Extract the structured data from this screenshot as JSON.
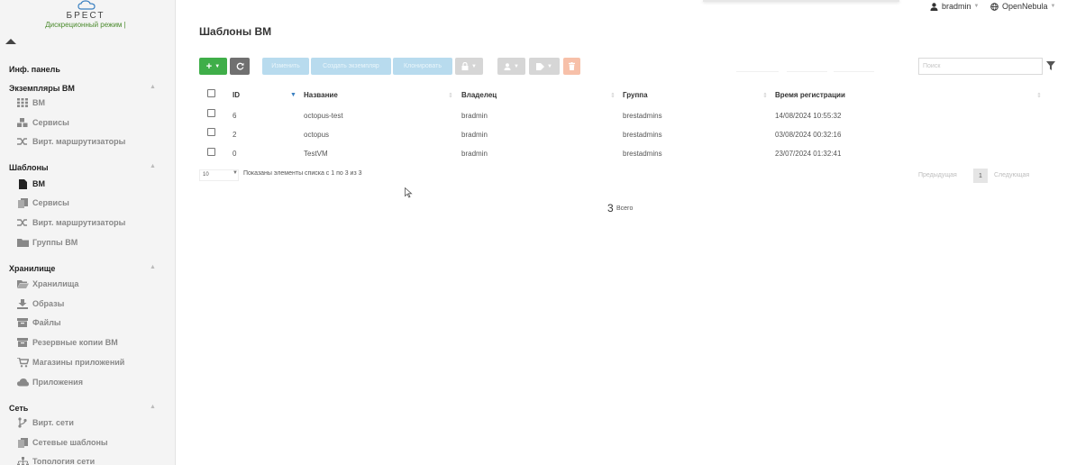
{
  "brand": {
    "name": "БРЕСТ",
    "mode": "Дискреционный режим",
    "mode_suffix": "|"
  },
  "header": {
    "page_title": "Шаблоны ВМ",
    "user": "bradmin",
    "cloud": "OpenNebula"
  },
  "sidebar": {
    "dashboard": "Инф. панель",
    "sections": [
      {
        "title": "Экземпляры ВМ",
        "items": [
          {
            "label": "ВМ",
            "icon": "grid-icon"
          },
          {
            "label": "Сервисы",
            "icon": "cubes-icon"
          },
          {
            "label": "Вирт. маршрутизаторы",
            "icon": "random-icon"
          }
        ]
      },
      {
        "title": "Шаблоны",
        "items": [
          {
            "label": "ВМ",
            "icon": "file-icon",
            "active": true
          },
          {
            "label": "Сервисы",
            "icon": "copy-icon"
          },
          {
            "label": "Вирт. маршрутизаторы",
            "icon": "random-icon"
          },
          {
            "label": "Группы ВМ",
            "icon": "folder-icon"
          }
        ]
      },
      {
        "title": "Хранилище",
        "items": [
          {
            "label": "Хранилища",
            "icon": "folder-open-icon"
          },
          {
            "label": "Образы",
            "icon": "download-icon"
          },
          {
            "label": "Файлы",
            "icon": "archive-icon"
          },
          {
            "label": "Резервные копии ВМ",
            "icon": "archive-icon"
          },
          {
            "label": "Магазины приложений",
            "icon": "cart-icon"
          },
          {
            "label": "Приложения",
            "icon": "cloud-icon"
          }
        ]
      },
      {
        "title": "Сеть",
        "items": [
          {
            "label": "Вирт. сети",
            "icon": "branch-icon"
          },
          {
            "label": "Сетевые шаблоны",
            "icon": "copy-icon"
          },
          {
            "label": "Топология сети",
            "icon": "sitemap-icon"
          }
        ]
      }
    ]
  },
  "toolbar": {
    "add": "+",
    "refresh_icon": "refresh-icon",
    "update": "Изменить",
    "instantiate": "Создать экземпляр",
    "clone": "Клонировать",
    "lock_icon": "lock-icon",
    "user_icon": "user-icon",
    "tag_icon": "tag-icon",
    "delete_icon": "trash-icon"
  },
  "search": {
    "placeholder": "Поиск"
  },
  "table": {
    "columns": [
      "ID",
      "Название",
      "Владелец",
      "Группа",
      "Время регистрации"
    ],
    "rows": [
      {
        "id": "6",
        "name": "octopus-test",
        "owner": "bradmin",
        "group": "brestadmins",
        "time": "14/08/2024 10:55:32"
      },
      {
        "id": "2",
        "name": "octopus",
        "owner": "bradmin",
        "group": "brestadmins",
        "time": "03/08/2024 00:32:16"
      },
      {
        "id": "0",
        "name": "TestVM",
        "owner": "bradmin",
        "group": "brestadmins",
        "time": "23/07/2024 01:32:41"
      }
    ]
  },
  "footer": {
    "page_size": "10",
    "showing": "Показаны элементы списка с 1 по 3 из 3",
    "prev": "Предыдущая",
    "page": "1",
    "next": "Следующая",
    "total": "3",
    "total_label": "Всего"
  },
  "colors": {
    "green": "#3fae49",
    "blue": "#3a80c1",
    "light_blue": "#b8dbee",
    "salmon": "#f7c0a9"
  }
}
